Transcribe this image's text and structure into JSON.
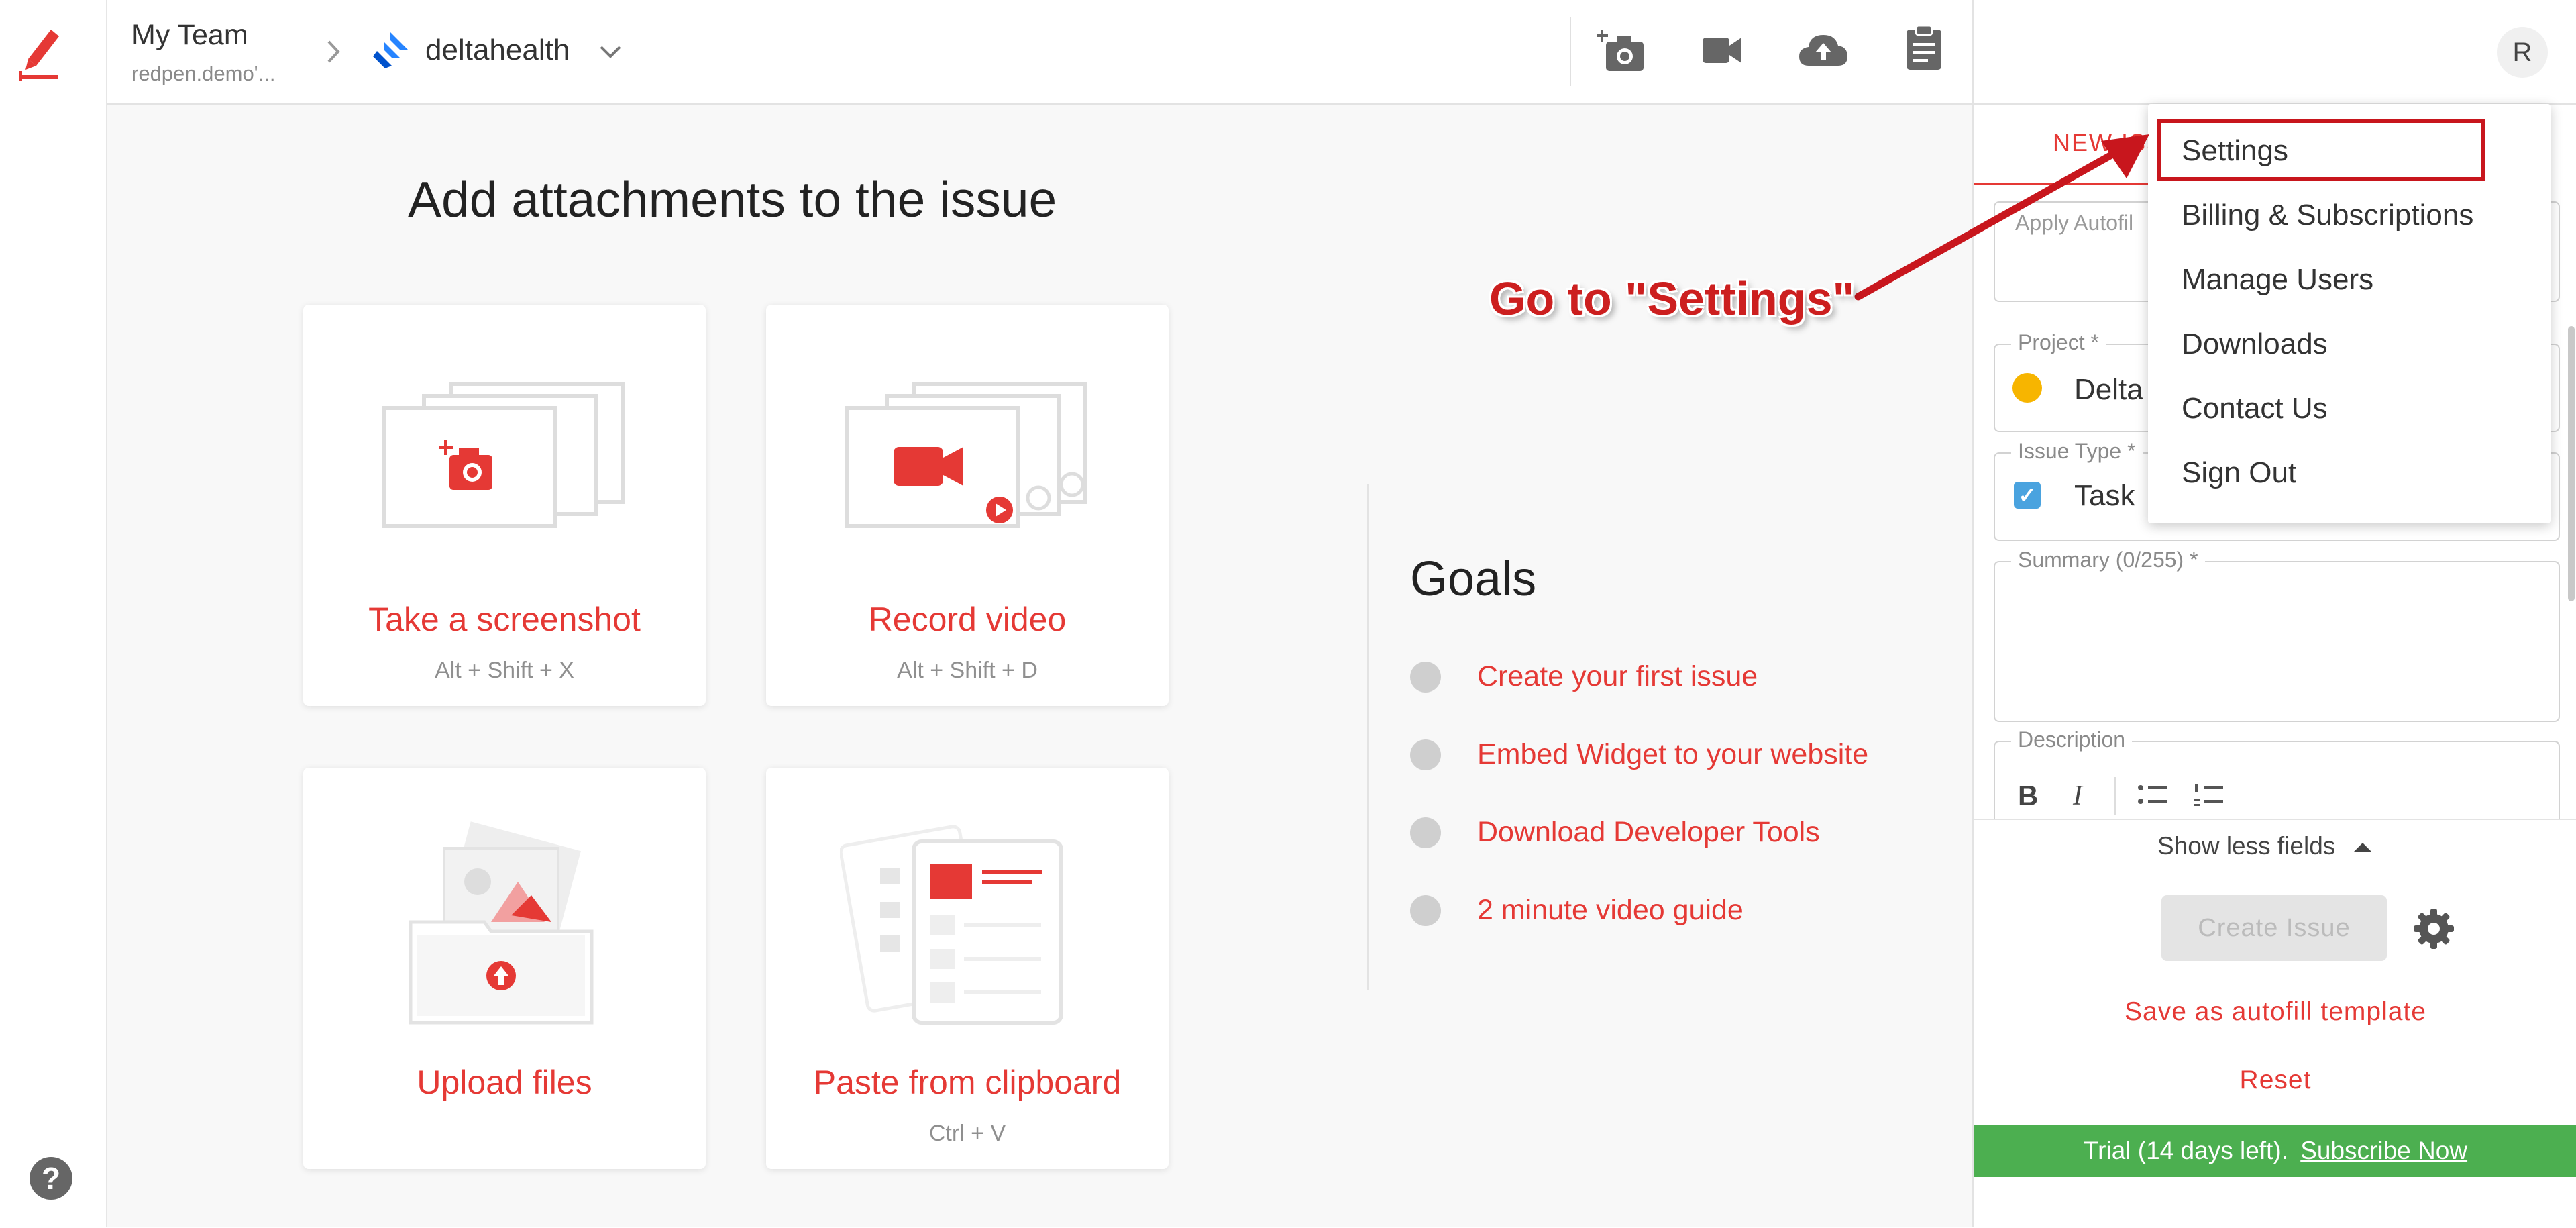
{
  "header": {
    "team_name": "My Team",
    "team_sub": "redpen.demo'...",
    "project_name": "deltahealth",
    "avatar_letter": "R"
  },
  "main": {
    "heading": "Add attachments to the issue",
    "cards": [
      {
        "title": "Take a screenshot",
        "shortcut": "Alt + Shift + X"
      },
      {
        "title": "Record video",
        "shortcut": "Alt + Shift + D"
      },
      {
        "title": "Upload files",
        "shortcut": ""
      },
      {
        "title": "Paste from clipboard",
        "shortcut": "Ctrl + V"
      }
    ]
  },
  "goals": {
    "title": "Goals",
    "items": [
      "Create your first issue",
      "Embed Widget to your website",
      "Download Developer Tools",
      "2 minute video guide"
    ]
  },
  "panel": {
    "tab_new_issue": "NEW ISS",
    "autofill_placeholder": "Apply Autofil",
    "project_label": "Project *",
    "project_value": "Delta",
    "issue_type_label": "Issue Type *",
    "issue_type_value": "Task",
    "summary_label": "Summary (0/255) *",
    "description_label": "Description",
    "bold": "B",
    "italic": "I",
    "show_less": "Show less fields",
    "create_issue": "Create Issue",
    "save_template": "Save as autofill template",
    "reset": "Reset",
    "trial_text": "Trial (14 days left).",
    "subscribe": "Subscribe Now"
  },
  "menu": {
    "items": [
      "Settings",
      "Billing & Subscriptions",
      "Manage Users",
      "Downloads",
      "Contact Us",
      "Sign Out"
    ]
  },
  "annotation": {
    "text": "Go to \"Settings\""
  },
  "colors": {
    "brand_red": "#e53935",
    "trial_green": "#4caf50",
    "jira_blue": "#2684ff"
  }
}
